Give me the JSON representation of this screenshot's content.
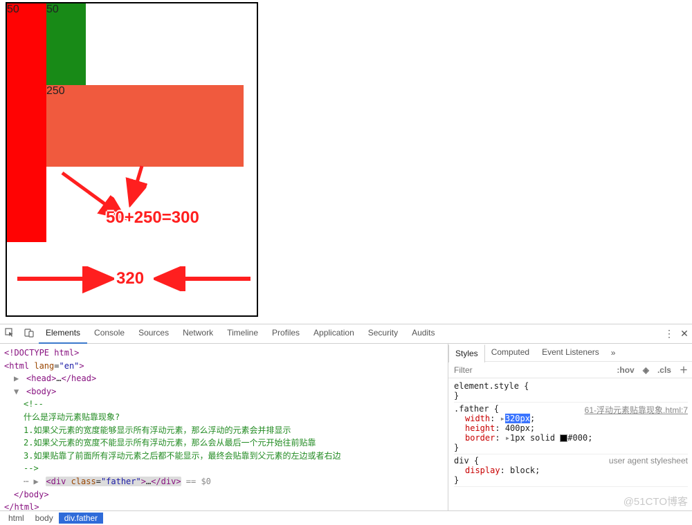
{
  "viewport": {
    "red_label": "50",
    "green_label": "50",
    "orange_label": "250",
    "annotation_sum": "50+250=300",
    "annotation_width": "320"
  },
  "devtools": {
    "tabs": [
      "Elements",
      "Console",
      "Sources",
      "Network",
      "Timeline",
      "Profiles",
      "Application",
      "Security",
      "Audits"
    ],
    "active_tab": "Elements",
    "elements": {
      "doctype": "<!DOCTYPE html>",
      "html_open": "<html lang=\"en\">",
      "head": "<head>…</head>",
      "body_open": "<body>",
      "comment_lines": [
        "<!--",
        "什么是浮动元素贴靠现象?",
        "1.如果父元素的宽度能够显示所有浮动元素，那么浮动的元素会并排显示",
        "2.如果父元素的宽度不能显示所有浮动元素，那么会从最后一个元开始往前贴靠",
        "3.如果贴靠了前面所有浮动元素之后都不能显示，最终会贴靠到父元素的左边或者右边",
        "-->"
      ],
      "selected_line": "<div class=\"father\">…</div>",
      "selected_suffix": " == $0",
      "body_close": "</body>",
      "html_close": "</html>"
    },
    "crumbs": [
      "html",
      "body",
      "div.father"
    ],
    "styles": {
      "tabs": [
        "Styles",
        "Computed",
        "Event Listeners"
      ],
      "filter_placeholder": "Filter",
      "hov": ":hov",
      "cls": ".cls",
      "element_style": "element.style {",
      "rule_father": {
        "selector": ".father {",
        "source": "61-浮动元素贴靠现象.html:7",
        "width_name": "width",
        "width_val_hl": "320px",
        "width_val_tail": ";",
        "height_name": "height",
        "height_val": "400px;",
        "border_name": "border",
        "border_val_prefix": "1px solid ",
        "border_val_color": "#000;"
      },
      "rule_div": {
        "selector": "div {",
        "source": "user agent stylesheet",
        "display_name": "display",
        "display_val": "block;"
      },
      "brace_close": "}"
    }
  },
  "watermark": "@51CTO博客"
}
